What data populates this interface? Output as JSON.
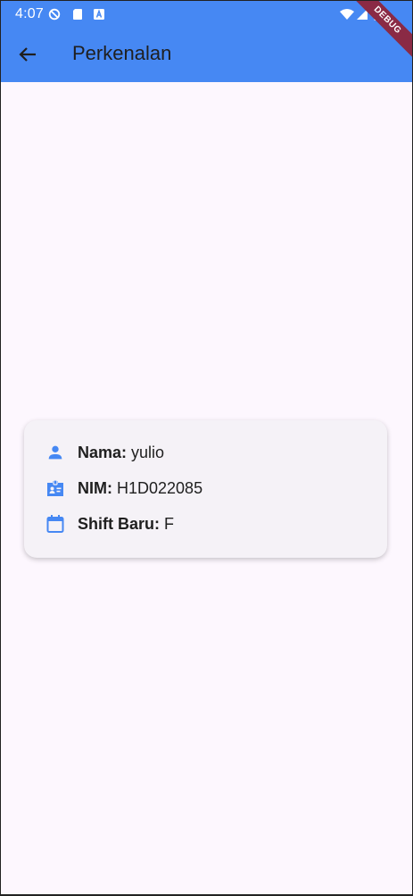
{
  "status_bar": {
    "time": "4:07",
    "icons": [
      "vpn-icon",
      "sd-card-icon",
      "a-icon",
      "wifi-icon",
      "signal-icon",
      "battery-icon"
    ]
  },
  "app_bar": {
    "title": "Perkenalan",
    "back_icon": "arrow-back-icon",
    "color": "#4688f3"
  },
  "debug_banner": "DEBUG",
  "profile": {
    "rows": [
      {
        "icon": "person-icon",
        "label": "Nama:",
        "value": "yulio"
      },
      {
        "icon": "badge-icon",
        "label": "NIM:",
        "value": "H1D022085"
      },
      {
        "icon": "calendar-icon",
        "label": "Shift Baru:",
        "value": "F"
      }
    ],
    "icon_color": "#4688f3"
  }
}
